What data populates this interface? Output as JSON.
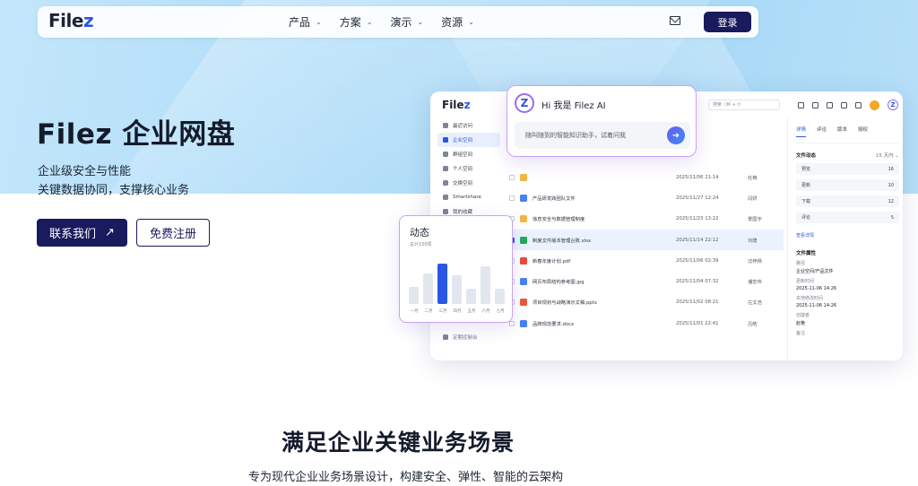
{
  "nav": {
    "logo_main": "File",
    "logo_z": "z",
    "menu": [
      "产品",
      "方案",
      "演示",
      "资源"
    ],
    "login": "登录"
  },
  "hero": {
    "title": "Filez 企业网盘",
    "subtitle1": "企业级安全与性能",
    "subtitle2": "关键数据协同，支撑核心业务",
    "contact_label": "联系我们",
    "register_label": "免费注册"
  },
  "app": {
    "logo_main": "File",
    "logo_z": "z",
    "search_placeholder": "搜索（⌘ + r）",
    "sidebar": [
      "最近访问",
      "企业空间",
      "群组空间",
      "个人空间",
      "交换空间",
      "Smartshare",
      "我的收藏"
    ],
    "sidebar_active": 1,
    "sidebar_footer": "定期控制台",
    "files": [
      {
        "name": "",
        "date": "2025/11/06 21:14",
        "user": "杜楠",
        "color": "#f5b640"
      },
      {
        "name": "产品研发跨团队文件",
        "date": "2025/11/27 12:24",
        "user": "闫妍",
        "color": "#4a80f0"
      },
      {
        "name": "信息安全与数据管理制度",
        "date": "2025/11/23 13:22",
        "user": "景国宇",
        "color": "#f5b640"
      },
      {
        "name": "制度文件版本管理台账.xlsx",
        "date": "2025/11/14 22:12",
        "user": "刘荫",
        "color": "#25a85a"
      },
      {
        "name": "新春年度计划.pdf",
        "date": "2025/11/06 02:39",
        "user": "沈梓杨",
        "color": "#e84b3c"
      },
      {
        "name": "网页布局结构参考图.jpg",
        "date": "2025/11/04 07:32",
        "user": "潘宏伟",
        "color": "#4a80f0"
      },
      {
        "name": "项目规划与战略演示文稿.pptx",
        "date": "2025/11/02 08:21",
        "user": "左文浩",
        "color": "#e85a3c"
      },
      {
        "name": "品牌规范要求.docx",
        "date": "2025/11/01 22:41",
        "user": "吕皓",
        "color": "#4a80f0"
      }
    ],
    "selected_file": 3,
    "detail": {
      "tabs": [
        "详情",
        "评论",
        "版本",
        "授权"
      ],
      "active_tab": 0,
      "activity_title": "文件动态",
      "activity_range": "15 天内",
      "stats": [
        {
          "label": "预览",
          "value": "16"
        },
        {
          "label": "更新",
          "value": "10"
        },
        {
          "label": "下载",
          "value": "12"
        },
        {
          "label": "评论",
          "value": "5"
        }
      ],
      "more_link": "查看详情",
      "props_title": "文件属性",
      "props": [
        {
          "label": "路径",
          "value": "企业空间/产品文件"
        },
        {
          "label": "更新时间",
          "value": "2025-11-06 14:26"
        },
        {
          "label": "本地修改时间",
          "value": "2025-11-06 14:26"
        },
        {
          "label": "创建者",
          "value": "赵艳"
        },
        {
          "label": "备注",
          "value": ""
        }
      ]
    }
  },
  "ai_card": {
    "title": "Hi 我是 Filez AI",
    "logo": "Z",
    "input_placeholder": "随叫随到的智能知识助手，试着问我"
  },
  "activity_card": {
    "title": "动态",
    "subtitle": "总计150项",
    "bar_labels": [
      "一月",
      "二月",
      "三月",
      "四月",
      "五月",
      "六月",
      "七月"
    ],
    "bar_values": [
      0.3,
      0.55,
      0.72,
      0.52,
      0.28,
      0.67,
      0.28
    ],
    "highlight_index": 2
  },
  "section": {
    "title": "满足企业关键业务场景",
    "subtitle": "专为现代企业业务场景设计，构建安全、弹性、智能的云架构"
  }
}
